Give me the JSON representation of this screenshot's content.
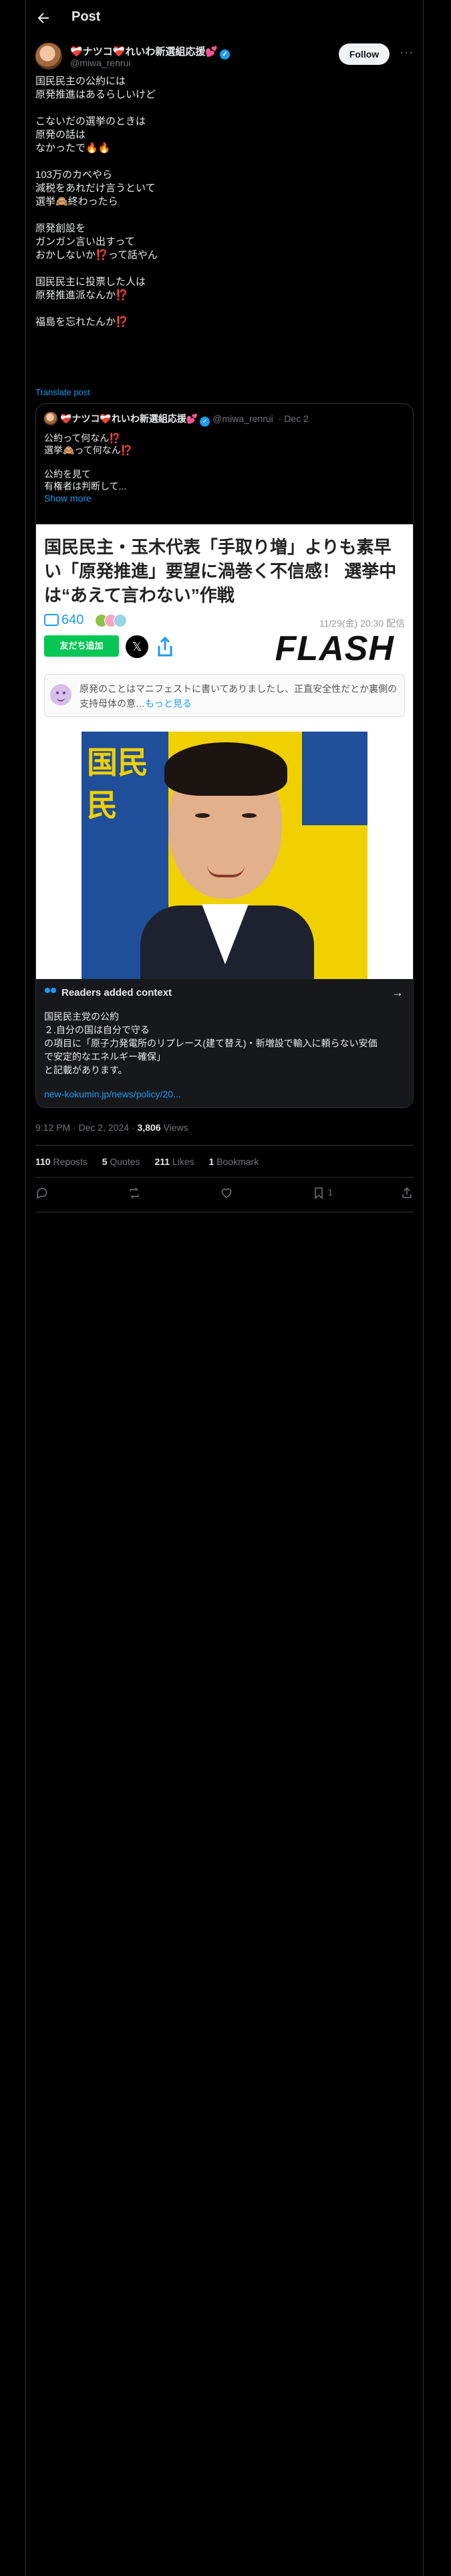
{
  "header": {
    "title": "Post"
  },
  "author": {
    "name": "❤️‍🩹ナツコ❤️‍🩹れいわ新選組応援💕",
    "handle": "@miwa_renrui",
    "follow_label": "Follow"
  },
  "post": {
    "lines": [
      "国民民主の公約には",
      "原発推進はあるらしいけど",
      "",
      "こないだの選挙のときは",
      "原発の話は",
      "なかったで🔥🔥",
      "",
      "103万のカベやら",
      "減税をあれだけ言うといて",
      "選挙🙈終わったら",
      "",
      "原発創設を",
      "ガンガン言い出すって",
      "おかしないか⁉️って話やん",
      "",
      "国民民主に投票した人は",
      "原発推進派なんか⁉️",
      "",
      "福島を忘れたんか⁉️"
    ],
    "translate_label": "Translate post"
  },
  "quote": {
    "name": "❤️‍🩹ナツコ❤️‍🩹れいわ新選組応援💕",
    "handle": "@miwa_renrui",
    "date": "· Dec 2",
    "lines": [
      "公約って何なん⁉️",
      "選挙🙈って何なん⁉️",
      "",
      "公約を見て",
      "有権者は判断して..."
    ],
    "show_more": "Show more"
  },
  "article": {
    "title": "国民民主・玉木代表「手取り増」よりも素早い「原発推進」要望に渦巻く不信感！ 選挙中は“あえて言わない”作戦",
    "comments": "640",
    "date": "11/29(金) 20:30 配信",
    "line_label": "友だち追加",
    "x_label": "𝕏",
    "logo": "FLASH",
    "note": "原発のことはマニフェストに書いてありましたし、正直安全性だとか裏側の支持母体の意…",
    "note_more": "もっと見る",
    "banner_text": "国民民",
    "reaction_colors": [
      "#8bc34a",
      "#f6a6c0",
      "#9ad3e8"
    ]
  },
  "context": {
    "title": "Readers added context",
    "lines": [
      "国民民主党の公約",
      "２.自分の国は自分で守る",
      "の項目に「原子力発電所のリプレース(建て替え)・新増設で輸入に頼らない安価",
      "で安定的なエネルギー確保」",
      "と記載があります。"
    ],
    "link": "new-kokumin.jp/news/policy/20..."
  },
  "meta": {
    "time": "9:12 PM · Dec 2, 2024 · ",
    "views": "3,806",
    "views_label": " Views"
  },
  "stats": {
    "reposts": "110",
    "reposts_label": " Reposts",
    "quotes": "5",
    "quotes_label": " Quotes",
    "likes": "211",
    "likes_label": " Likes",
    "bookmarks": "1",
    "bookmarks_label": " Bookmark"
  },
  "actions": {
    "bookmark_count": "1"
  },
  "colors": {
    "accent": "#1d9bf0",
    "background": "#000000",
    "line_green": "#06c755"
  }
}
